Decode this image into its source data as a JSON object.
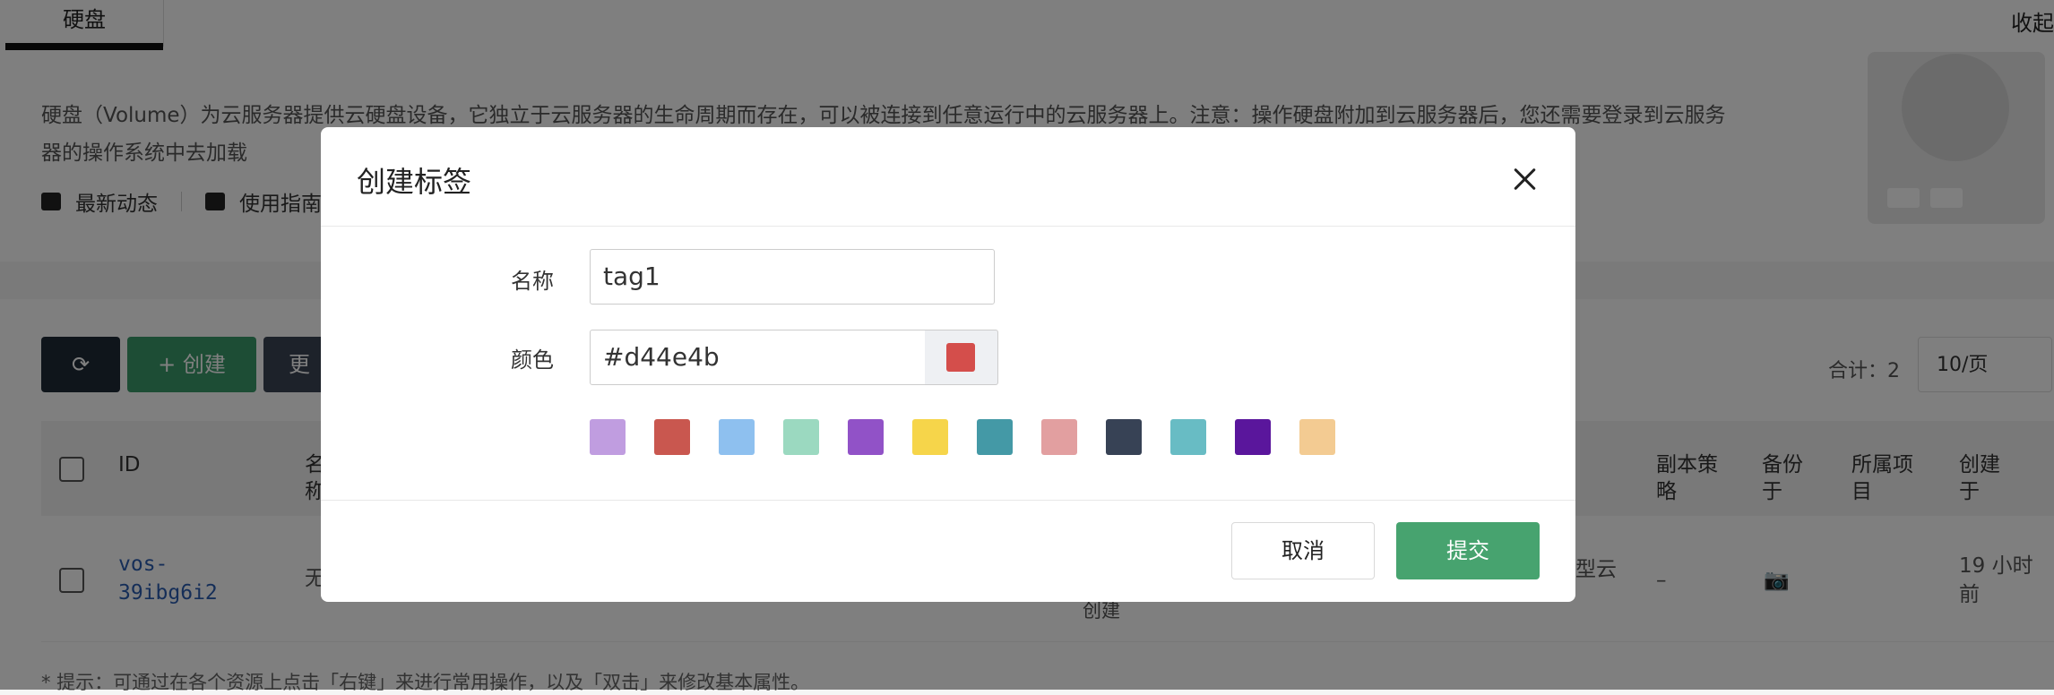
{
  "tabs": [
    {
      "label": "硬盘"
    }
  ],
  "collapse_label": "收起",
  "intro": {
    "text": "硬盘（Volume）为云服务器提供云硬盘设备，它独立于云服务器的生命周期而存在，可以被连接到任意运行中的云服务器上。注意：操作硬盘附加到云服务器后，您还需要登录到云服务器的操作系统中去加载",
    "links": [
      {
        "label": "最新动态"
      },
      {
        "label": "使用指南"
      }
    ]
  },
  "toolbar": {
    "create_label": "+ 创建",
    "more_label": "更"
  },
  "pagination": {
    "total_label": "合计：2",
    "page_size": "10/页"
  },
  "table": {
    "headers": [
      "ID",
      "名称",
      "副本策略",
      "备份于",
      "所属项目",
      "创建于"
    ],
    "rows": [
      {
        "id": "vos-39ibg6i2",
        "name": "无",
        "type": "型云",
        "created_by": "创建",
        "replica": "–",
        "created": "19 小时前"
      }
    ]
  },
  "hint": "* 提示：可通过在各个资源上点击「右键」来进行常用操作，以及「双击」来修改基本属性。",
  "dialog": {
    "title": "创建标签",
    "name_label": "名称",
    "name_value": "tag1",
    "color_label": "颜色",
    "color_value": "#d44e4b",
    "selected_color": "#d44e4b",
    "palette": [
      "#c09de0",
      "#c9574f",
      "#8ec0ef",
      "#9bd9c0",
      "#9152c7",
      "#f6d54a",
      "#4499a6",
      "#e29fa0",
      "#374255",
      "#68bcc4",
      "#5a169c",
      "#f3cb92"
    ],
    "cancel_label": "取消",
    "submit_label": "提交"
  }
}
